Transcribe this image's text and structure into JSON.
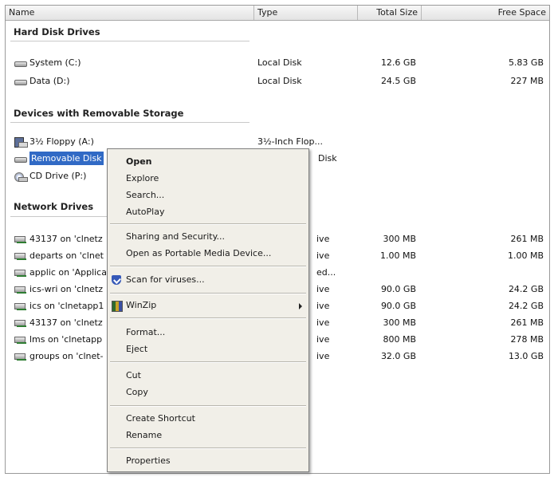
{
  "columns": {
    "name": "Name",
    "type": "Type",
    "total_size": "Total Size",
    "free_space": "Free Space"
  },
  "groups": {
    "hard_disk": "Hard Disk Drives",
    "removable": "Devices with Removable Storage",
    "network": "Network Drives"
  },
  "hard_disks": [
    {
      "name": "System (C:)",
      "type": "Local Disk",
      "total": "12.6 GB",
      "free": "5.83 GB",
      "icon": "hard-disk-icon"
    },
    {
      "name": "Data (D:)",
      "type": "Local Disk",
      "total": "24.5 GB",
      "free": "227 MB",
      "icon": "hard-disk-icon"
    }
  ],
  "removable": [
    {
      "name": "3½ Floppy (A:)",
      "type": "3½-Inch Flop...",
      "icon": "floppy-icon"
    },
    {
      "name": "Removable Disk",
      "type": "Disk",
      "icon": "removable-disk-icon"
    },
    {
      "name": "CD Drive (P:)",
      "icon": "cd-drive-icon"
    }
  ],
  "network": [
    {
      "name": "43137 on 'clnetz",
      "type": "ive",
      "total": "300 MB",
      "free": "261 MB"
    },
    {
      "name": "departs on 'clnet",
      "type": "ive",
      "total": "1.00 MB",
      "free": "1.00 MB"
    },
    {
      "name": "applic on 'Applica",
      "type": "ed..."
    },
    {
      "name": "ics-wri on 'clnetz",
      "type": "ive",
      "total": "90.0 GB",
      "free": "24.2 GB"
    },
    {
      "name": "ics on 'clnetapp1",
      "type": "ive",
      "total": "90.0 GB",
      "free": "24.2 GB"
    },
    {
      "name": "43137 on 'clnetz",
      "type": "ive",
      "total": "300 MB",
      "free": "261 MB"
    },
    {
      "name": "lms on 'clnetapp",
      "type": "ive",
      "total": "800 MB",
      "free": "278 MB"
    },
    {
      "name": "groups on 'clnet-",
      "type": "ive",
      "total": "32.0 GB",
      "free": "13.0 GB"
    }
  ],
  "context_menu": {
    "open": "Open",
    "explore": "Explore",
    "search": "Search...",
    "autoplay": "AutoPlay",
    "sharing": "Sharing and Security...",
    "portable": "Open as Portable Media Device...",
    "scan": "Scan for viruses...",
    "winzip": "WinZip",
    "format": "Format...",
    "eject": "Eject",
    "cut": "Cut",
    "copy": "Copy",
    "shortcut": "Create Shortcut",
    "rename": "Rename",
    "properties": "Properties"
  },
  "colors": {
    "selection": "#316ac5",
    "menu_bg": "#f1efe8"
  }
}
